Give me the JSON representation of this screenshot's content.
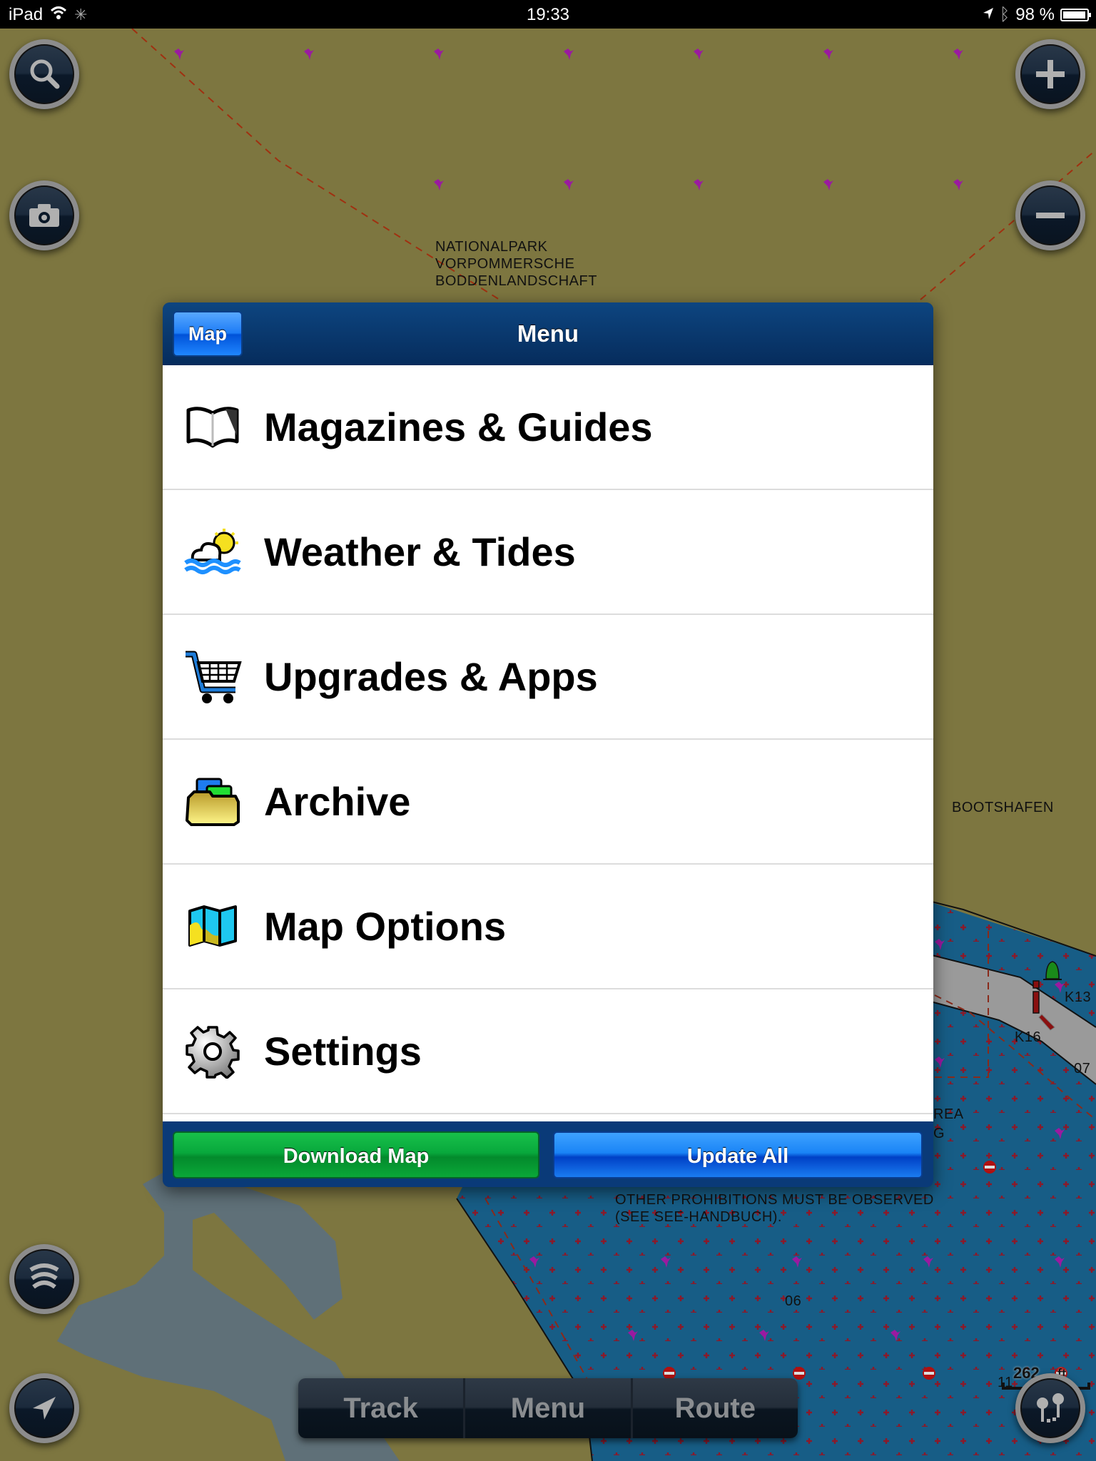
{
  "status_bar": {
    "device": "iPad",
    "time": "19:33",
    "battery": "98 %"
  },
  "map": {
    "labels": {
      "park_line1": "NATIONALPARK",
      "park_line2": "VORPOMMERSCHE",
      "park_line3": "BODDENLANDSCHAFT",
      "harbor": "BOOTSHAFEN",
      "buoy_k13": "K13",
      "buoy_k16": "K16",
      "depth_07": "07",
      "depth_06": "06",
      "depth_11": "11",
      "area_fragment_1": "REA",
      "area_fragment_2": "G",
      "notice_line1": "OTHER PROHIBITIONS MUST BE OBSERVED",
      "notice_line2": "(SEE SEE-HANDBUCH)."
    },
    "scale": {
      "value": "262",
      "unit": "ft"
    },
    "colors": {
      "land": "#7d7640",
      "water": "#175d86",
      "shallow": "#5f7078",
      "channel": "#9a9a9a"
    }
  },
  "map_controls": {
    "search": "search",
    "camera": "camera",
    "zoom_in": "zoom-in",
    "zoom_out": "zoom-out",
    "sonar": "sonar",
    "locate": "locate",
    "route_tool": "route-tool"
  },
  "menu": {
    "title": "Menu",
    "back_label": "Map",
    "items": [
      {
        "label": "Magazines & Guides",
        "icon": "book-icon"
      },
      {
        "label": "Weather & Tides",
        "icon": "weather-icon"
      },
      {
        "label": "Upgrades & Apps",
        "icon": "cart-icon"
      },
      {
        "label": "Archive",
        "icon": "folder-icon"
      },
      {
        "label": "Map Options",
        "icon": "map-icon"
      },
      {
        "label": "Settings",
        "icon": "gear-icon"
      }
    ],
    "download_label": "Download Map",
    "update_label": "Update All",
    "colors": {
      "header": "#0a3a78",
      "download": "#08a83c",
      "update": "#1a84f6"
    }
  },
  "toolbar": {
    "track_label": "Track",
    "menu_label": "Menu",
    "route_label": "Route"
  }
}
